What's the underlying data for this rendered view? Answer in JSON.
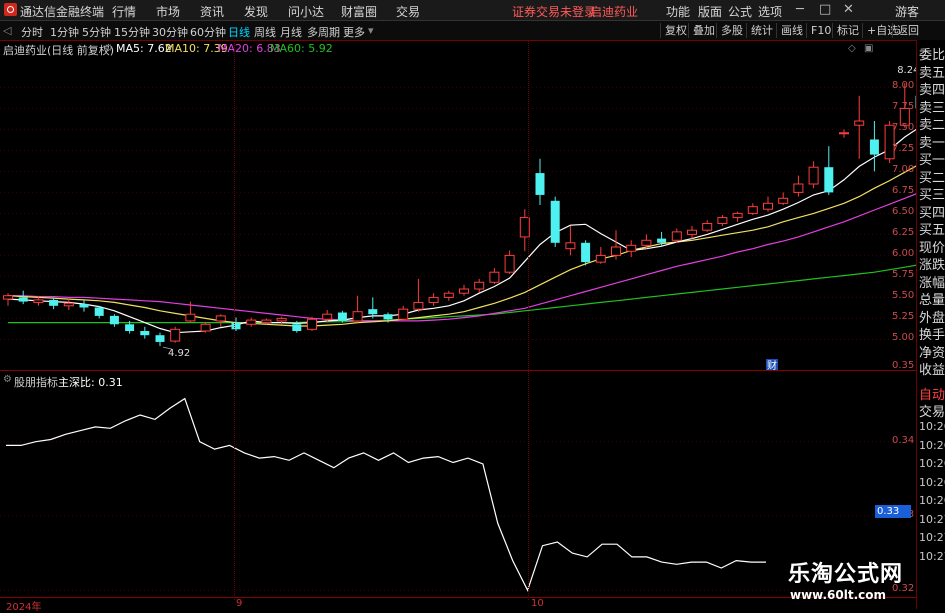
{
  "menubar": {
    "app_title": "通达信金融终端",
    "items": [
      "行情",
      "市场",
      "资讯",
      "发现",
      "问小达",
      "财富圈",
      "交易"
    ],
    "login_notice": "证券交易未登录",
    "stock_link": "启迪药业",
    "right_items": [
      "功能",
      "版面",
      "公式",
      "选项"
    ],
    "guest": "游客"
  },
  "toolbar": {
    "periods": [
      "分时",
      "1分钟",
      "5分钟",
      "15分钟",
      "30分钟",
      "60分钟",
      "日线",
      "周线",
      "月线",
      "多周期",
      "更多"
    ],
    "active_period": "日线",
    "right_buttons": [
      "复权",
      "叠加",
      "多股",
      "统计",
      "画线",
      "F10",
      "标记",
      "+自选",
      "返回"
    ]
  },
  "main_info": {
    "stock_label": "启迪药业(日线 前复权)",
    "ma5": "MA5: 7.62",
    "ma10": "MA10: 7.39",
    "ma20": "MA20: 6.83",
    "ma60": "MA60: 5.92"
  },
  "colors": {
    "up": "#ff3c3c",
    "down": "#4ff0f0",
    "ma5": "#ffffff",
    "ma10": "#f0e060",
    "ma20": "#e040e0",
    "ma60": "#20c020",
    "grid": "#6a0000"
  },
  "main_axis": {
    "labels": [
      "8.00",
      "7.75",
      "7.50",
      "7.25",
      "7.00",
      "6.75",
      "6.50",
      "6.25",
      "6.00",
      "5.75",
      "5.50",
      "5.25",
      "5.00"
    ],
    "high_label": "8.24",
    "low_label": "4.92",
    "cai_marker": "财"
  },
  "indicator": {
    "title": "股朋指标",
    "line_label": "主深比: 0.31",
    "axis_labels": [
      "0.35",
      "0.34",
      "0.33",
      "0.32"
    ],
    "current_badge": "0.33"
  },
  "x_axis": {
    "labels": [
      "2024年",
      "9",
      "10"
    ]
  },
  "sidebar": {
    "items": [
      "委比",
      "卖五",
      "卖四",
      "卖三",
      "卖二",
      "卖一",
      "买一",
      "买二",
      "买三",
      "买四",
      "买五",
      "现价",
      "涨跌",
      "涨幅",
      "总量",
      "外盘",
      "换手",
      "净资",
      "收益"
    ],
    "bottom_items": [
      "自动",
      "交易"
    ],
    "times": [
      "10:26",
      "10:26",
      "10:26",
      "10:26",
      "10:26",
      "10:27",
      "10:27",
      "10:27"
    ]
  },
  "watermark": {
    "title": "乐淘公式网",
    "url": "www.60lt.com"
  },
  "chart_data": {
    "type": "candlestick",
    "candles": [
      {
        "o": 5.48,
        "c": 5.52,
        "h": 5.55,
        "l": 5.4
      },
      {
        "o": 5.5,
        "c": 5.45,
        "h": 5.58,
        "l": 5.42
      },
      {
        "o": 5.44,
        "c": 5.47,
        "h": 5.52,
        "l": 5.4
      },
      {
        "o": 5.47,
        "c": 5.4,
        "h": 5.5,
        "l": 5.36
      },
      {
        "o": 5.4,
        "c": 5.43,
        "h": 5.48,
        "l": 5.35
      },
      {
        "o": 5.42,
        "c": 5.38,
        "h": 5.47,
        "l": 5.33
      },
      {
        "o": 5.38,
        "c": 5.28,
        "h": 5.4,
        "l": 5.25
      },
      {
        "o": 5.28,
        "c": 5.18,
        "h": 5.3,
        "l": 5.15
      },
      {
        "o": 5.18,
        "c": 5.1,
        "h": 5.22,
        "l": 5.07
      },
      {
        "o": 5.1,
        "c": 5.05,
        "h": 5.15,
        "l": 5.01
      },
      {
        "o": 5.05,
        "c": 4.97,
        "h": 5.08,
        "l": 4.92
      },
      {
        "o": 4.98,
        "c": 5.12,
        "h": 5.15,
        "l": 4.96
      },
      {
        "o": 5.22,
        "c": 5.3,
        "h": 5.45,
        "l": 5.2
      },
      {
        "o": 5.1,
        "c": 5.18,
        "h": 5.21,
        "l": 5.08
      },
      {
        "o": 5.22,
        "c": 5.28,
        "h": 5.3,
        "l": 5.15
      },
      {
        "o": 5.2,
        "c": 5.12,
        "h": 5.26,
        "l": 5.1
      },
      {
        "o": 5.18,
        "c": 5.23,
        "h": 5.26,
        "l": 5.15
      },
      {
        "o": 5.2,
        "c": 5.23,
        "h": 5.25,
        "l": 5.18
      },
      {
        "o": 5.22,
        "c": 5.25,
        "h": 5.27,
        "l": 5.18
      },
      {
        "o": 5.18,
        "c": 5.1,
        "h": 5.22,
        "l": 5.08
      },
      {
        "o": 5.12,
        "c": 5.24,
        "h": 5.27,
        "l": 5.1
      },
      {
        "o": 5.24,
        "c": 5.3,
        "h": 5.35,
        "l": 5.2
      },
      {
        "o": 5.32,
        "c": 5.22,
        "h": 5.34,
        "l": 5.2
      },
      {
        "o": 5.22,
        "c": 5.33,
        "h": 5.52,
        "l": 5.2
      },
      {
        "o": 5.36,
        "c": 5.3,
        "h": 5.5,
        "l": 5.25
      },
      {
        "o": 5.3,
        "c": 5.24,
        "h": 5.32,
        "l": 5.2
      },
      {
        "o": 5.24,
        "c": 5.36,
        "h": 5.4,
        "l": 5.22
      },
      {
        "o": 5.36,
        "c": 5.44,
        "h": 5.72,
        "l": 5.33
      },
      {
        "o": 5.44,
        "c": 5.5,
        "h": 5.55,
        "l": 5.4
      },
      {
        "o": 5.5,
        "c": 5.55,
        "h": 5.58,
        "l": 5.46
      },
      {
        "o": 5.55,
        "c": 5.6,
        "h": 5.65,
        "l": 5.52
      },
      {
        "o": 5.6,
        "c": 5.68,
        "h": 5.72,
        "l": 5.56
      },
      {
        "o": 5.68,
        "c": 5.8,
        "h": 5.85,
        "l": 5.66
      },
      {
        "o": 5.8,
        "c": 6.0,
        "h": 6.06,
        "l": 5.78
      },
      {
        "o": 6.22,
        "c": 6.45,
        "h": 6.55,
        "l": 6.05
      },
      {
        "o": 6.98,
        "c": 6.72,
        "h": 7.15,
        "l": 6.6
      },
      {
        "o": 6.65,
        "c": 6.15,
        "h": 6.7,
        "l": 6.1
      },
      {
        "o": 6.08,
        "c": 6.15,
        "h": 6.35,
        "l": 6.0
      },
      {
        "o": 6.15,
        "c": 5.92,
        "h": 6.18,
        "l": 5.88
      },
      {
        "o": 5.92,
        "c": 6.0,
        "h": 6.1,
        "l": 5.9
      },
      {
        "o": 6.0,
        "c": 6.1,
        "h": 6.3,
        "l": 5.95
      },
      {
        "o": 6.05,
        "c": 6.12,
        "h": 6.18,
        "l": 5.98
      },
      {
        "o": 6.12,
        "c": 6.18,
        "h": 6.25,
        "l": 6.08
      },
      {
        "o": 6.2,
        "c": 6.15,
        "h": 6.28,
        "l": 6.12
      },
      {
        "o": 6.18,
        "c": 6.28,
        "h": 6.32,
        "l": 6.15
      },
      {
        "o": 6.25,
        "c": 6.3,
        "h": 6.35,
        "l": 6.2
      },
      {
        "o": 6.3,
        "c": 6.38,
        "h": 6.42,
        "l": 6.28
      },
      {
        "o": 6.38,
        "c": 6.45,
        "h": 6.48,
        "l": 6.35
      },
      {
        "o": 6.45,
        "c": 6.5,
        "h": 6.52,
        "l": 6.4
      },
      {
        "o": 6.5,
        "c": 6.58,
        "h": 6.62,
        "l": 6.48
      },
      {
        "o": 6.55,
        "c": 6.62,
        "h": 6.7,
        "l": 6.52
      },
      {
        "o": 6.62,
        "c": 6.68,
        "h": 6.75,
        "l": 6.6
      },
      {
        "o": 6.75,
        "c": 6.85,
        "h": 6.95,
        "l": 6.7
      },
      {
        "o": 6.85,
        "c": 7.05,
        "h": 7.12,
        "l": 6.8
      },
      {
        "o": 7.05,
        "c": 6.75,
        "h": 7.3,
        "l": 6.72
      },
      {
        "o": 7.45,
        "c": 7.46,
        "h": 7.5,
        "l": 7.4
      },
      {
        "o": 7.55,
        "c": 7.6,
        "h": 7.9,
        "l": 7.15
      },
      {
        "o": 7.38,
        "c": 7.2,
        "h": 7.6,
        "l": 7.0
      },
      {
        "o": 7.15,
        "c": 7.55,
        "h": 7.6,
        "l": 7.1
      },
      {
        "o": 7.55,
        "c": 7.75,
        "h": 8.05,
        "l": 7.52
      },
      {
        "o": 7.9,
        "c": 7.75,
        "h": 7.92,
        "l": 7.55
      },
      {
        "o": 7.6,
        "c": 7.95,
        "h": 8.24,
        "l": 7.58
      }
    ],
    "ma5": [
      5.48,
      5.47,
      5.46,
      5.45,
      5.44,
      5.42,
      5.39,
      5.34,
      5.27,
      5.2,
      5.13,
      5.08,
      5.09,
      5.1,
      5.14,
      5.17,
      5.22,
      5.2,
      5.2,
      5.19,
      5.2,
      5.22,
      5.23,
      5.26,
      5.28,
      5.28,
      5.3,
      5.35,
      5.37,
      5.4,
      5.46,
      5.55,
      5.63,
      5.73,
      5.93,
      6.13,
      6.27,
      6.36,
      6.37,
      6.26,
      6.16,
      6.06,
      6.08,
      6.11,
      6.16,
      6.2,
      6.25,
      6.31,
      6.37,
      6.43,
      6.48,
      6.55,
      6.63,
      6.72,
      6.77,
      6.9,
      7.06,
      7.17,
      7.26,
      7.41,
      7.53,
      7.62
    ],
    "ma10": [
      5.52,
      5.51,
      5.5,
      5.49,
      5.48,
      5.47,
      5.46,
      5.44,
      5.41,
      5.38,
      5.34,
      5.31,
      5.28,
      5.25,
      5.22,
      5.2,
      5.19,
      5.18,
      5.17,
      5.16,
      5.16,
      5.17,
      5.18,
      5.2,
      5.21,
      5.22,
      5.24,
      5.26,
      5.28,
      5.3,
      5.33,
      5.38,
      5.43,
      5.49,
      5.56,
      5.65,
      5.74,
      5.83,
      5.9,
      5.96,
      6.0,
      6.06,
      6.1,
      6.14,
      6.16,
      6.18,
      6.21,
      6.24,
      6.27,
      6.3,
      6.34,
      6.4,
      6.45,
      6.5,
      6.56,
      6.62,
      6.7,
      6.8,
      6.89,
      6.99,
      7.09,
      7.39
    ],
    "ma20": [
      5.52,
      5.52,
      5.51,
      5.51,
      5.5,
      5.5,
      5.49,
      5.48,
      5.47,
      5.46,
      5.45,
      5.43,
      5.41,
      5.39,
      5.37,
      5.35,
      5.33,
      5.31,
      5.29,
      5.27,
      5.25,
      5.24,
      5.23,
      5.22,
      5.22,
      5.22,
      5.22,
      5.22,
      5.23,
      5.24,
      5.26,
      5.28,
      5.31,
      5.34,
      5.37,
      5.42,
      5.47,
      5.52,
      5.57,
      5.62,
      5.67,
      5.72,
      5.77,
      5.82,
      5.87,
      5.91,
      5.95,
      5.99,
      6.04,
      6.08,
      6.13,
      6.17,
      6.22,
      6.28,
      6.34,
      6.4,
      6.47,
      6.54,
      6.61,
      6.68,
      6.75,
      6.83
    ],
    "ma60": [
      5.2,
      5.2,
      5.2,
      5.2,
      5.2,
      5.2,
      5.2,
      5.2,
      5.2,
      5.2,
      5.2,
      5.2,
      5.2,
      5.2,
      5.2,
      5.2,
      5.2,
      5.2,
      5.2,
      5.2,
      5.21,
      5.21,
      5.21,
      5.22,
      5.22,
      5.23,
      5.24,
      5.25,
      5.26,
      5.27,
      5.28,
      5.29,
      5.3,
      5.32,
      5.34,
      5.36,
      5.38,
      5.4,
      5.42,
      5.44,
      5.46,
      5.48,
      5.5,
      5.52,
      5.54,
      5.56,
      5.58,
      5.6,
      5.62,
      5.64,
      5.66,
      5.68,
      5.7,
      5.72,
      5.74,
      5.76,
      5.78,
      5.8,
      5.83,
      5.86,
      5.89,
      5.92
    ],
    "indicator": [
      0.3395,
      0.3395,
      0.34,
      0.3403,
      0.341,
      0.3415,
      0.342,
      0.3418,
      0.3428,
      0.3436,
      0.343,
      0.3445,
      0.3458,
      0.34,
      0.339,
      0.3395,
      0.3385,
      0.3378,
      0.338,
      0.3375,
      0.3385,
      0.3375,
      0.3365,
      0.3378,
      0.3385,
      0.3375,
      0.3385,
      0.3372,
      0.3378,
      0.338,
      0.3372,
      0.3378,
      0.337,
      0.329,
      0.324,
      0.32,
      0.326,
      0.3265,
      0.325,
      0.3245,
      0.3262,
      0.3262,
      0.3245,
      0.3245,
      0.3238,
      0.3235,
      0.3238,
      0.3238,
      0.323,
      0.324,
      0.3238,
      0.3238
    ],
    "ylim_main": [
      4.85,
      8.35
    ],
    "ylim_indicator": [
      0.3195,
      0.3475
    ]
  }
}
